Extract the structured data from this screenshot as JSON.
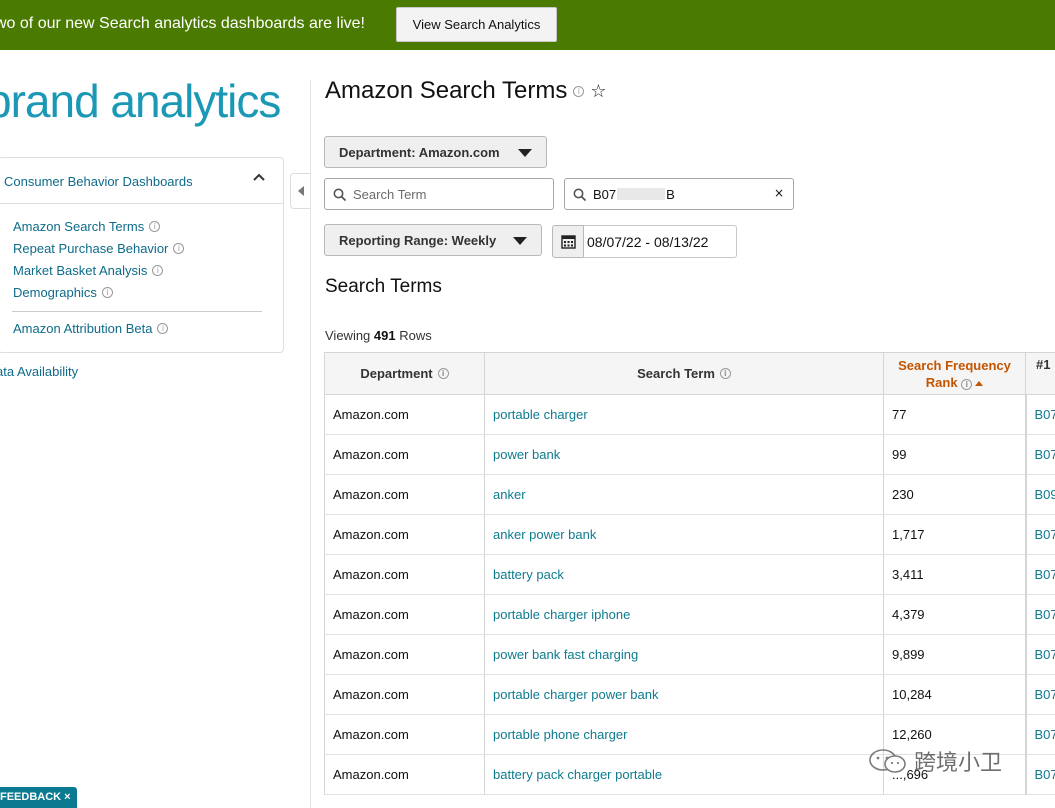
{
  "banner": {
    "text": "wo of our new Search analytics dashboards are live!",
    "button_label": "View Search Analytics"
  },
  "sidebar": {
    "logo": "brand analytics",
    "section_title": "Consumer Behavior Dashboards",
    "items": [
      {
        "label": "Amazon Search Terms",
        "icon": "info-icon"
      },
      {
        "label": "Repeat Purchase Behavior",
        "icon": "info-icon"
      },
      {
        "label": "Market Basket Analysis",
        "icon": "info-icon"
      },
      {
        "label": "Demographics",
        "icon": "info-icon"
      },
      {
        "label": "Amazon Attribution Beta",
        "icon": "info-icon"
      }
    ],
    "data_availability": "ata Availability"
  },
  "main": {
    "title": "Amazon Search Terms",
    "department_dropdown": "Department: Amazon.com",
    "search_term_placeholder": "Search Term",
    "asin_value_start": "B07",
    "asin_value_end": "B",
    "clear_symbol": "×",
    "reporting_range_dropdown": "Reporting Range: Weekly",
    "date_range": "08/07/22  -  08/13/22",
    "section_title": "Search Terms",
    "viewing_prefix": "Viewing",
    "viewing_count": "491",
    "viewing_suffix": "Rows"
  },
  "table": {
    "headers": {
      "department": "Department",
      "search_term": "Search Term",
      "sfr_line1": "Search Frequency",
      "sfr_line2": "Rank",
      "clicked": "#1"
    },
    "rows": [
      {
        "department": "Amazon.com",
        "term": "portable charger",
        "rank": "77",
        "asin": "B07"
      },
      {
        "department": "Amazon.com",
        "term": "power bank",
        "rank": "99",
        "asin": "B07"
      },
      {
        "department": "Amazon.com",
        "term": "anker",
        "rank": "230",
        "asin": "B09"
      },
      {
        "department": "Amazon.com",
        "term": "anker power bank",
        "rank": "1,717",
        "asin": "B07"
      },
      {
        "department": "Amazon.com",
        "term": "battery pack",
        "rank": "3,411",
        "asin": "B07"
      },
      {
        "department": "Amazon.com",
        "term": "portable charger iphone",
        "rank": "4,379",
        "asin": "B07"
      },
      {
        "department": "Amazon.com",
        "term": "power bank fast charging",
        "rank": "9,899",
        "asin": "B07"
      },
      {
        "department": "Amazon.com",
        "term": "portable charger power bank",
        "rank": "10,284",
        "asin": "B07"
      },
      {
        "department": "Amazon.com",
        "term": "portable phone charger",
        "rank": "12,260",
        "asin": "B07"
      },
      {
        "department": "Amazon.com",
        "term": "battery pack charger portable",
        "rank": "...,696",
        "asin": "B07"
      }
    ]
  },
  "feedback": "FEEDBACK ×",
  "watermark": "跨境小卫",
  "colors": {
    "banner": "#4a7b00",
    "link": "#0e7b8f",
    "accent": "#c45500",
    "logo": "#1a98b5"
  }
}
